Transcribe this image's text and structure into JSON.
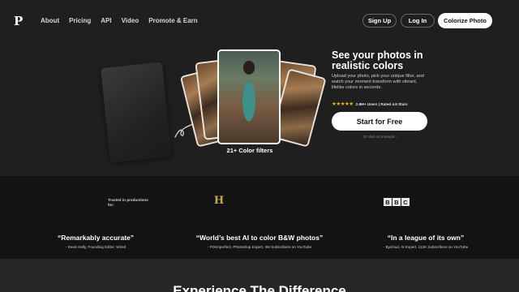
{
  "brand": {
    "logo": "P"
  },
  "nav": {
    "links": [
      "About",
      "Pricing",
      "API",
      "Video",
      "Promote & Earn"
    ],
    "signup": "Sign Up",
    "login": "Log In",
    "colorize": "Colorize Photo"
  },
  "hero": {
    "headline": "See your photos in realistic colors",
    "description": "Upload your photo, pick your unique filter, and watch your moment transform with vibrant, lifelike colors in seconds.",
    "stars": "★★★★★",
    "rating_text": "2.8M+ Users | Rated 4.9 Stars",
    "cta": "Start for Free",
    "sample_hint": "Or click on a sample ↓",
    "filters_label": "21+ Color filters"
  },
  "trust": {
    "label": "Trusted in productions for:",
    "history_logo": "H",
    "bbc_logo": [
      "B",
      "B",
      "C"
    ],
    "quotes": [
      {
        "quote": "“Remarkably accurate”",
        "author": "- Kevin Kelly, Founding Editor, Wired"
      },
      {
        "quote": "“World’s best AI to color B&W photos”",
        "author": "- PiXimperfect, Photoshop Expert, 4M Subscribers on YouTube"
      },
      {
        "quote": "“In a league of its own”",
        "author": "- Bycloud, AI Expert, 112K Subscribers on YouTube"
      }
    ]
  },
  "section": {
    "heading": "Experience The Difference"
  },
  "colors": {
    "background": "#201f20",
    "trust_band": "#131313",
    "star": "#f3b21c",
    "accent_white": "#ffffff"
  },
  "icons": [
    "arrow-doodle-icon",
    "star-icon",
    "history-logo-icon",
    "bbc-logo-icon"
  ]
}
